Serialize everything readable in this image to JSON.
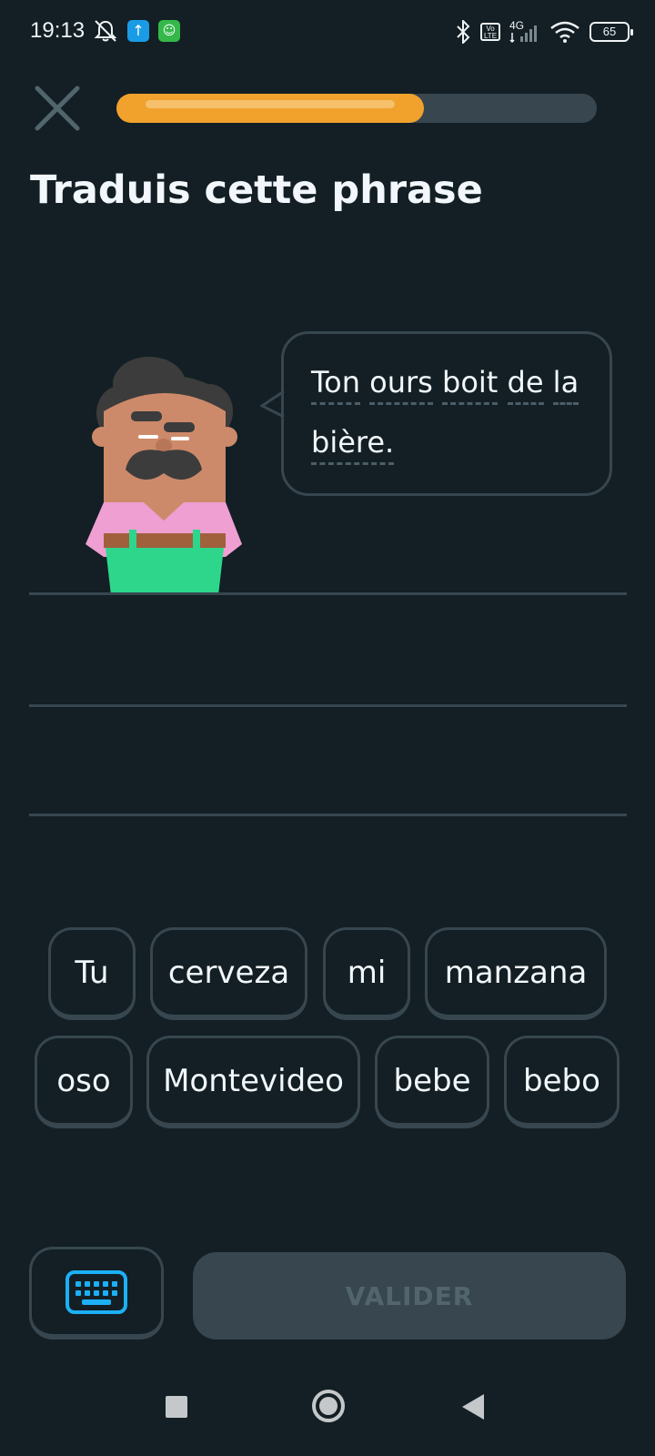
{
  "status_bar": {
    "time": "19:13",
    "network_top": "4G",
    "volte": "Vo LTE",
    "battery": "65",
    "icons": [
      "mute-icon",
      "upload-app-icon",
      "android-app-icon",
      "bluetooth-icon",
      "volte-icon",
      "signal-icon",
      "wifi-icon",
      "battery-icon"
    ]
  },
  "header": {
    "progress_fraction": 0.64,
    "close_icon": "close-icon"
  },
  "title": "Traduis cette phrase",
  "prompt": {
    "line1_words": [
      "Ton",
      "ours",
      "boit",
      "de",
      "la"
    ],
    "line2_words": [
      "bière."
    ]
  },
  "word_bank": {
    "row1": [
      "Tu",
      "cerveza",
      "mi",
      "manzana"
    ],
    "row2": [
      "oso",
      "Montevideo",
      "bebe",
      "bebo"
    ]
  },
  "bottom": {
    "keyboard_icon": "keyboard-icon",
    "check_label": "VALIDER"
  },
  "colors": {
    "background": "#131f24",
    "progress": "#f0a22d",
    "border": "#37464f",
    "keyboard_accent": "#1cb0f6"
  }
}
